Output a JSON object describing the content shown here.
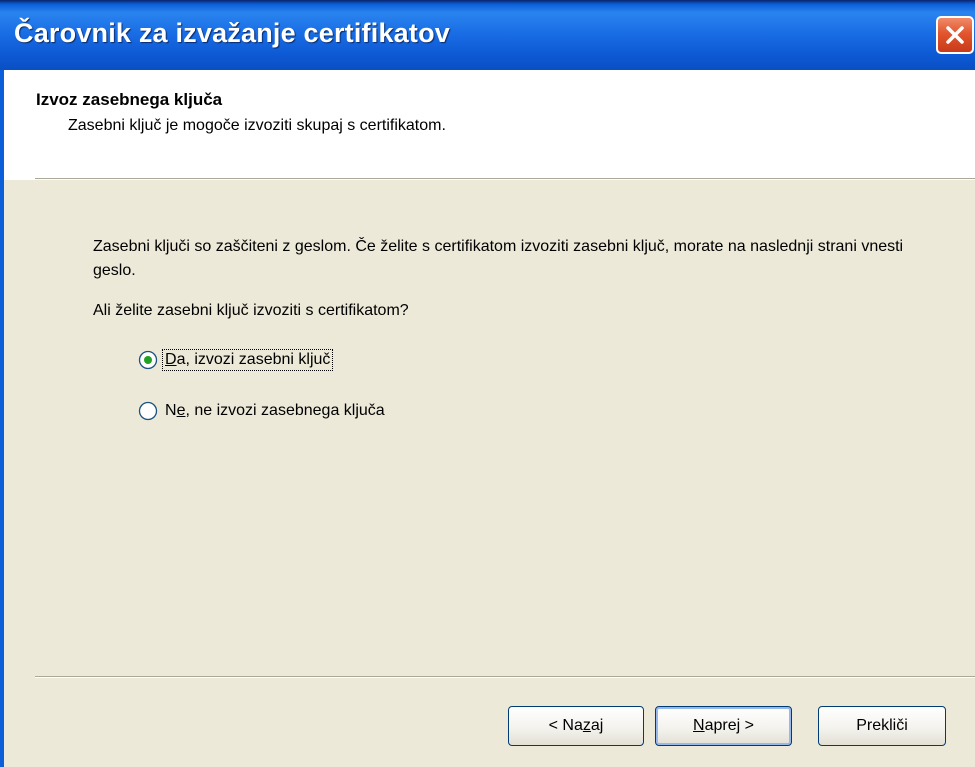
{
  "window": {
    "title": "Čarovnik za izvažanje certifikatov",
    "close_icon": "close-icon"
  },
  "header": {
    "title": "Izvoz zasebnega ključa",
    "subtitle": "Zasebni ključ je mogoče izvoziti skupaj s certifikatom."
  },
  "main": {
    "description": "Zasebni ključi so zaščiteni z geslom. Če želite s certifikatom izvoziti zasebni ključ, morate na naslednji strani vnesti geslo.",
    "question": "Ali želite zasebni ključ izvoziti s certifikatom?",
    "options": [
      {
        "label_mnemonic": "D",
        "label_rest": "a, izvozi zasebni ključ",
        "selected": true
      },
      {
        "label_pre": "N",
        "label_mnemonic": "e",
        "label_rest": ", ne izvozi zasebnega ključa",
        "selected": false
      }
    ]
  },
  "buttons": {
    "back_pre": "< Na",
    "back_mnemonic": "z",
    "back_post": "aj",
    "next_mnemonic": "N",
    "next_post": "aprej >",
    "cancel": "Prekliči"
  },
  "colors": {
    "titlebar": "#0b5fd8",
    "dialog_bg": "#ece9d8",
    "close_button": "#e2552d",
    "radio_selected": "#21a121"
  }
}
